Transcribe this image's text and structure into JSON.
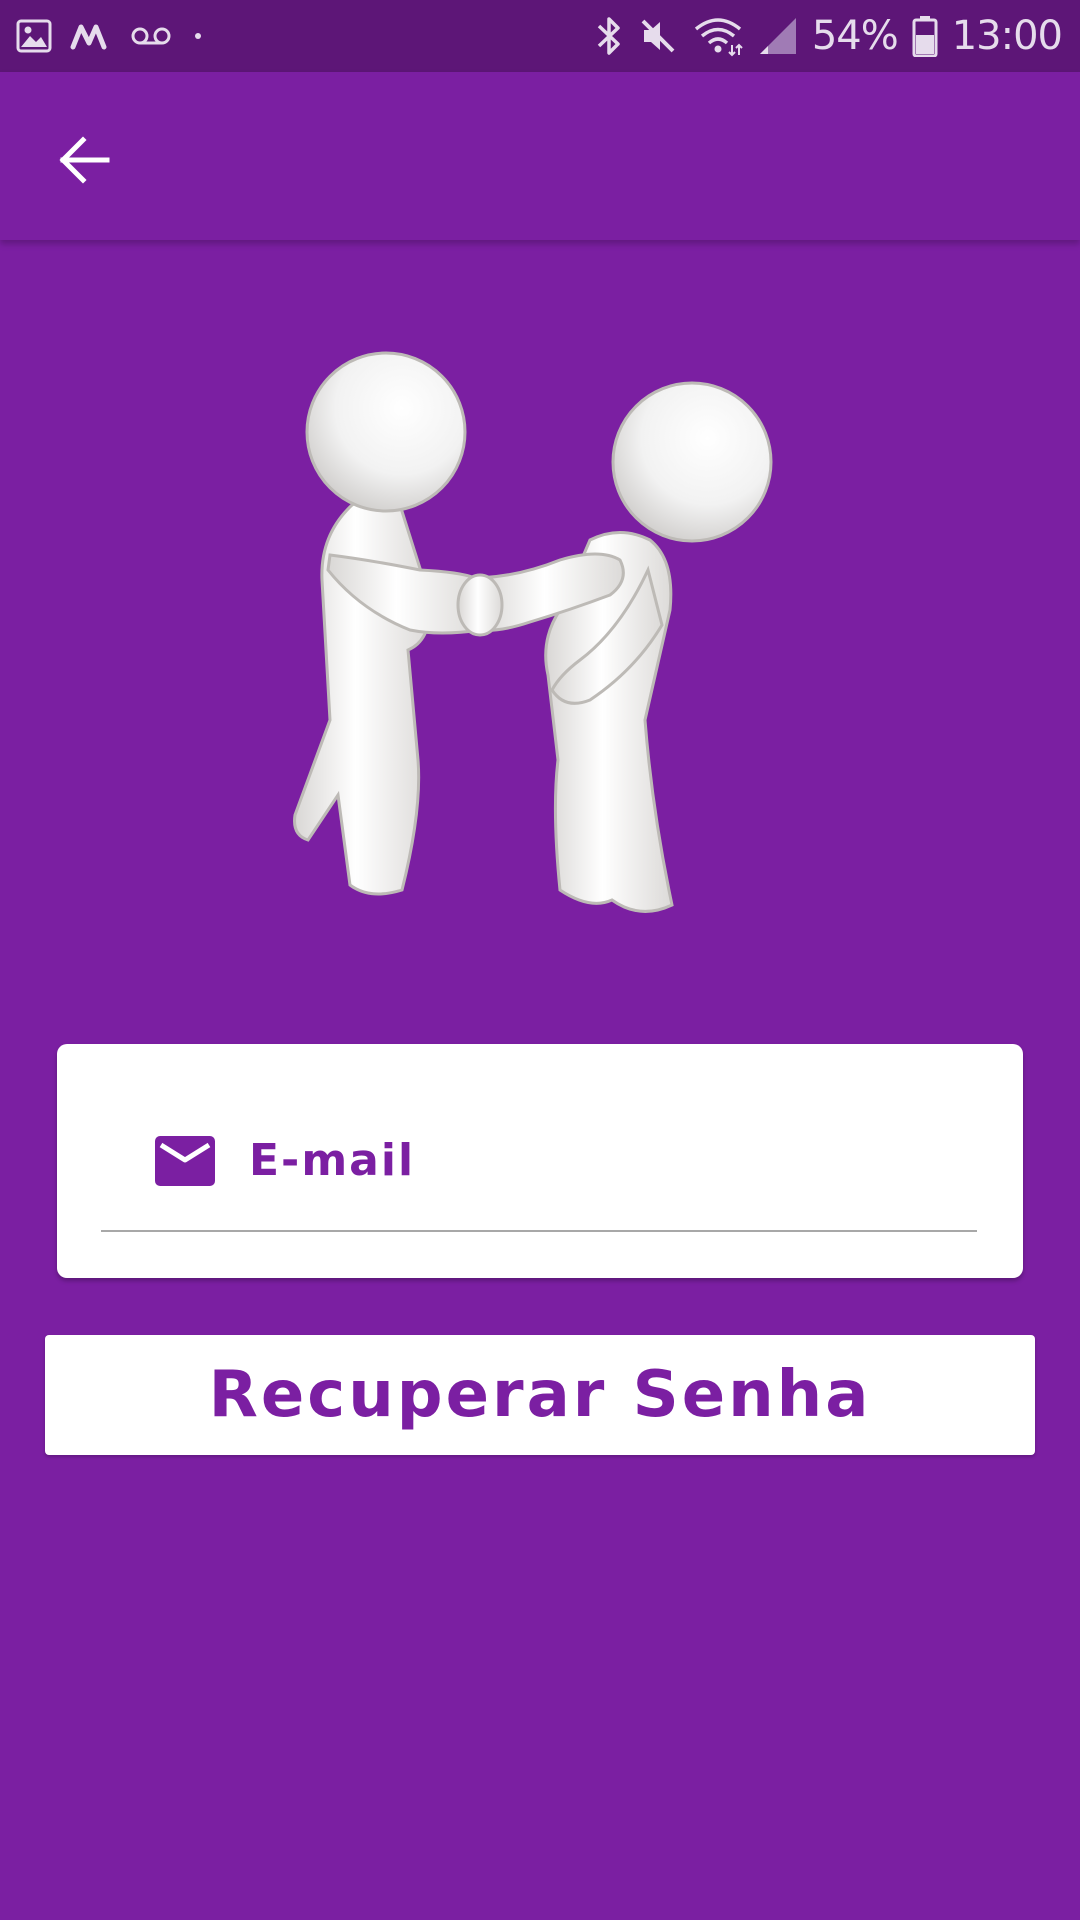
{
  "status_bar": {
    "battery_percent": "54%",
    "time": "13:00",
    "left_icons": [
      "gallery-icon",
      "m-app-icon",
      "voicemail-icon",
      "dot-icon"
    ],
    "right_icons": [
      "bluetooth-icon",
      "mute-icon",
      "wifi-icon",
      "signal-icon",
      "battery-icon"
    ]
  },
  "app_bar": {
    "back_icon": "arrow-back-icon"
  },
  "illustration": {
    "icon": "handshake-figures-icon"
  },
  "email_field": {
    "placeholder": "E-mail",
    "value": "",
    "icon": "mail-icon"
  },
  "recover_button": {
    "label": "Recuperar Senha"
  },
  "colors": {
    "primary": "#7b1fa2",
    "status_bar": "#5d1677",
    "surface": "#ffffff"
  }
}
